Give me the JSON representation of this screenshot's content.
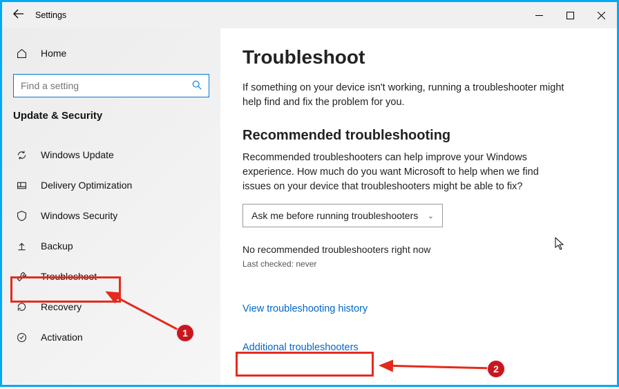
{
  "window": {
    "title": "Settings"
  },
  "sidebar": {
    "home": "Home",
    "search_placeholder": "Find a setting",
    "group": "Update & Security",
    "items": [
      {
        "label": "Windows Update"
      },
      {
        "label": "Delivery Optimization"
      },
      {
        "label": "Windows Security"
      },
      {
        "label": "Backup"
      },
      {
        "label": "Troubleshoot"
      },
      {
        "label": "Recovery"
      },
      {
        "label": "Activation"
      }
    ]
  },
  "main": {
    "title": "Troubleshoot",
    "intro": "If something on your device isn't working, running a troubleshooter might help find and fix the problem for you.",
    "section_title": "Recommended troubleshooting",
    "section_body": "Recommended troubleshooters can help improve your Windows experience. How much do you want Microsoft to help when we find issues on your device that troubleshooters might be able to fix?",
    "dropdown_selected": "Ask me before running troubleshooters",
    "no_recommended": "No recommended troubleshooters right now",
    "last_checked": "Last checked: never",
    "link_history": "View troubleshooting history",
    "link_additional": "Additional troubleshooters"
  },
  "annotations": {
    "badge1": "1",
    "badge2": "2"
  }
}
